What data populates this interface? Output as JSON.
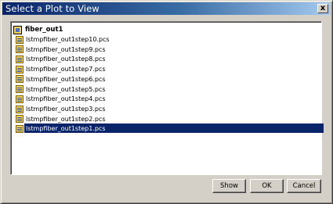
{
  "window": {
    "title": "Select a Plot to View",
    "close_label": "x"
  },
  "tree": {
    "root_label": "fiber_out1",
    "root_icon": "folder-icon",
    "file_icon": "plot-file-icon",
    "files": [
      {
        "name": "lstmpfiber_out1step10.pcs",
        "selected": false
      },
      {
        "name": "lstmpfiber_out1step9.pcs",
        "selected": false
      },
      {
        "name": "lstmpfiber_out1step8.pcs",
        "selected": false
      },
      {
        "name": "lstmpfiber_out1step7.pcs",
        "selected": false
      },
      {
        "name": "lstmpfiber_out1step6.pcs",
        "selected": false
      },
      {
        "name": "lstmpfiber_out1step5.pcs",
        "selected": false
      },
      {
        "name": "lstmpfiber_out1step4.pcs",
        "selected": false
      },
      {
        "name": "lstmpfiber_out1step3.pcs",
        "selected": false
      },
      {
        "name": "lstmpfiber_out1step2.pcs",
        "selected": false
      },
      {
        "name": "lstmpfiber_out1step1.pcs",
        "selected": true
      }
    ]
  },
  "buttons": {
    "show": "Show",
    "ok": "OK",
    "cancel": "Cancel"
  },
  "colors": {
    "titlebar_start": "#0a246a",
    "selection": "#0a246a",
    "dialog_face": "#d4d0c8"
  }
}
